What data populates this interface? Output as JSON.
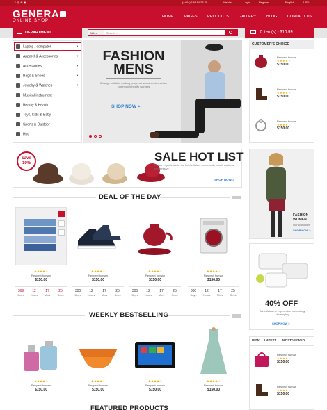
{
  "colors": {
    "brand": "#c8102e",
    "link": "#2a7bd1",
    "star": "#f2a900"
  },
  "topbar": {
    "phone": "(+404) 158 14 25 78",
    "wishlist": "Wishlist",
    "login": "Login",
    "register": "Register",
    "language": "English",
    "currency": "USD"
  },
  "header": {
    "logo_main": "GENERA",
    "logo_sub": "ONLINE SHOP",
    "nav": [
      "HOME",
      "PAGES",
      "PRODUCTS",
      "GALLERY",
      "BLOG",
      "CONTACT US"
    ]
  },
  "searchbar": {
    "department": "DEPARTMENT",
    "category": "ALL",
    "placeholder": "Search...",
    "cart": "0 item(s) - $10.99"
  },
  "sidebar": {
    "items": [
      "Laptop / computer",
      "Apparel & Accessories",
      "Accessories",
      "Bags & Shoes",
      "Jewelry & Watches",
      "Musical instrument",
      "Beauty & Health",
      "Toys, Kids & Baby",
      "Sports & Outdoor",
      "Hot"
    ]
  },
  "hero": {
    "title": "FASHION MENS",
    "subtitle": "Change initiative making progress social worker action community health workers",
    "button": "SHOP NOW >"
  },
  "choice": {
    "title": "CUSTOMER'S CHOICE",
    "products": [
      {
        "name": "Respect human",
        "price": "$150.00"
      },
      {
        "name": "Respect human",
        "price": "$150.00"
      },
      {
        "name": "Respect human",
        "price": "$150.00"
      }
    ]
  },
  "sale": {
    "badge_line1": "save",
    "badge_line2": "10%",
    "title": "SALE HOT LIST",
    "subtitle": "Future experience in the field efficient community health workers progressive",
    "button": "SHOP NOW >"
  },
  "deal": {
    "title": "DEAL OF THE DAY",
    "products": [
      {
        "name": "Respect human",
        "price": "$150.00",
        "days": "369",
        "hours": "12",
        "mins": "17",
        "secs": "25"
      },
      {
        "name": "Respect human",
        "price": "$150.00",
        "days": "300",
        "hours": "12",
        "mins": "17",
        "secs": "25"
      },
      {
        "name": "Respect human",
        "price": "$150.00",
        "days": "300",
        "hours": "12",
        "mins": "17",
        "secs": "25"
      },
      {
        "name": "Respect human",
        "price": "$150.00",
        "days": "300",
        "hours": "12",
        "mins": "17",
        "secs": "25"
      }
    ],
    "labels": {
      "days": "Days",
      "hours": "Hours",
      "mins": "Mins",
      "secs": "Secs"
    }
  },
  "fashion_women": {
    "title": "FASHION WOMEN",
    "subtitle": "Our wardrobe",
    "button": "SHOP NOW >"
  },
  "off": {
    "title": "40% OFF",
    "subtitle": "Jane Addams improvable technology developing",
    "button": "SHOP NOW >"
  },
  "weekly": {
    "title": "WEEKLY BESTSELLING",
    "products": [
      {
        "name": "Respect human",
        "price": "$150.00"
      },
      {
        "name": "Respect human",
        "price": "$150.00"
      },
      {
        "name": "Respect human",
        "price": "$150.00"
      },
      {
        "name": "Respect human",
        "price": "$150.00"
      }
    ]
  },
  "tabs": {
    "items": [
      "NEW",
      "LATEST",
      "MOST VIEWED"
    ],
    "products": [
      {
        "name": "Respect human",
        "price": "$150.00"
      },
      {
        "name": "Respect human",
        "price": "$150.00"
      }
    ]
  },
  "featured": {
    "title": "FEATURED PRODUCTS"
  },
  "rating": "★★★★☆"
}
